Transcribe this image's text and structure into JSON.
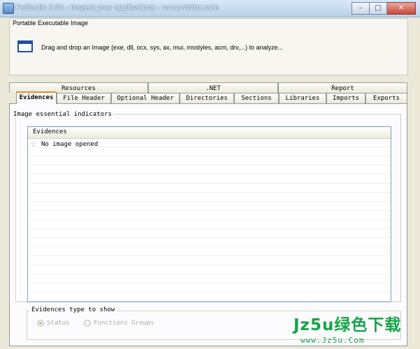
{
  "window": {
    "title": "PeStudio 3.54 - Inspect your applications - www.winitor.com",
    "controls": {
      "minimize": "–",
      "maximize": "□",
      "close": "✕"
    }
  },
  "pe_section": {
    "title": "Portable Executable Image",
    "instruction": "Drag and drop an Image (exe, dll, ocx, sys, ax, mui, msstyles, acm, drv,...) to analyze..."
  },
  "tabs": {
    "row1": [
      "Resources",
      ".NET",
      "Report"
    ],
    "row2": [
      "Evidences",
      "File Header",
      "Optional Header",
      "Directories",
      "Sections",
      "Libraries",
      "Imports",
      "Exports"
    ],
    "active": "Evidences"
  },
  "indicators": {
    "group_title": "Image essential indicators",
    "column_header": "Evidences",
    "rows": [
      {
        "icon": "star-icon",
        "text": "No image opened"
      }
    ]
  },
  "evidence_type": {
    "group_title": "Evidences type to show",
    "options": [
      {
        "label": "Status",
        "checked": true
      },
      {
        "label": "Functions Groups",
        "checked": false
      }
    ]
  },
  "watermark": {
    "main": "Jz5u绿色下载",
    "sub": "www.Jz5u.Com"
  }
}
